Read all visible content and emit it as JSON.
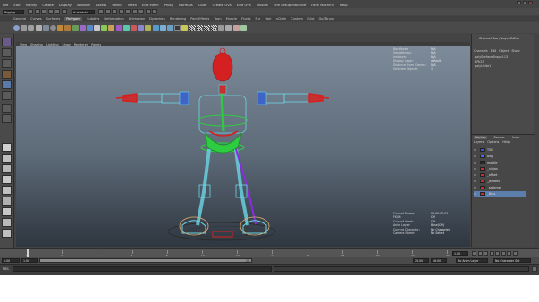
{
  "menubar": {
    "items": [
      "File",
      "Edit",
      "Modify",
      "Create",
      "Display",
      "Window",
      "Assets",
      "Select",
      "Mesh",
      "Edit Mesh",
      "Proxy",
      "Normals",
      "Color",
      "Create UVs",
      "Edit UVs",
      "Muscle",
      "The Setup Machine",
      "Face Machine",
      "Help"
    ]
  },
  "statusline": {
    "mode": "Rigging",
    "search": "ik stretchi"
  },
  "shelf": {
    "tabs": [
      "General",
      "Curves",
      "Surfaces",
      "Polygons",
      "Subdivs",
      "Deformation",
      "Animation",
      "Dynamics",
      "Rendering",
      "PaintEffects",
      "Toon",
      "Muscle",
      "Fluids",
      "Fur",
      "Hair",
      "nCloth",
      "Custom",
      "Glut",
      "GoZBrush"
    ],
    "active": "Polygons"
  },
  "viewport": {
    "menu": [
      "View",
      "Shading",
      "Lighting",
      "Show",
      "Renderer",
      "Panels"
    ],
    "hud_top": [
      {
        "key": "Backfaces:",
        "value": "N/A"
      },
      {
        "key": "Smoothness:",
        "value": "N/A"
      },
      {
        "key": "Instance:",
        "value": "N/A"
      },
      {
        "key": "Display Layer:",
        "value": "default"
      },
      {
        "key": "Distance From Camera:",
        "value": "N/A"
      },
      {
        "key": "Selected Objects:",
        "value": "1"
      }
    ],
    "hud_bottom": [
      {
        "key": "Current Frame:",
        "value": "00:00:00:01"
      },
      {
        "key": "FK/IK:",
        "value": "Off"
      },
      {
        "key": "Current Asset:",
        "value": "Off"
      },
      {
        "key": "Anim Layer:",
        "value": "Base(Off)"
      },
      {
        "key": "Current Character:",
        "value": "No Character"
      },
      {
        "key": "Camera Name:",
        "value": "No Select"
      }
    ]
  },
  "channel_box": {
    "title": "Channel Box / Layer Editor",
    "menu": [
      "Channels",
      "Edit",
      "Object",
      "Show"
    ],
    "objects": [
      "polySurfaceShape113",
      "BPk23",
      "polyUnite1"
    ],
    "layer_tabs": [
      "Display",
      "Render",
      "Anim"
    ],
    "layer_menu": [
      "Layers",
      "Options",
      "Help"
    ],
    "layers": [
      {
        "vis": "V",
        "name": "TSM",
        "color": "#2b5bd8",
        "selected": false
      },
      {
        "vis": "V",
        "name": "Bag",
        "color": "#3b6bff",
        "selected": false
      },
      {
        "vis": "V",
        "name": "mobile",
        "color": "#2a2a2a",
        "selected": false
      },
      {
        "vis": "V",
        "name": "_ninjas",
        "color": "#d02a2a",
        "selected": false
      },
      {
        "vis": "V",
        "name": "_offset",
        "color": "#d02a2a",
        "selected": false
      },
      {
        "vis": "V",
        "name": "_jambes",
        "color": "#d02a2a",
        "selected": false
      },
      {
        "vis": "V",
        "name": "_salleme",
        "color": "#d02a2a",
        "selected": false
      },
      {
        "vis": "V",
        "name": "_Bras",
        "color": "#d02a2a",
        "selected": true
      }
    ]
  },
  "timeline": {
    "ticks": [
      "1",
      "2",
      "4",
      "6",
      "8",
      "10",
      "12",
      "14",
      "16",
      "18",
      "20",
      "22",
      "24"
    ],
    "current_frame": "1.00"
  },
  "range": {
    "start": "1.00",
    "inner_start": "1.00",
    "inner_end": "24",
    "end_a": "24.00",
    "end_b": "48.00",
    "anim_layer": "No Anim Layer",
    "character": "No Character Set"
  },
  "cmdline": {
    "label": "MEL"
  },
  "colors": {
    "ui_bg": "#444444",
    "mesh_red": "#d42020",
    "joint_cyan": "#6cd6e6",
    "control_green": "#2ecc40",
    "control_purple": "#8a2be2",
    "wire_blue": "#3f64c8"
  }
}
